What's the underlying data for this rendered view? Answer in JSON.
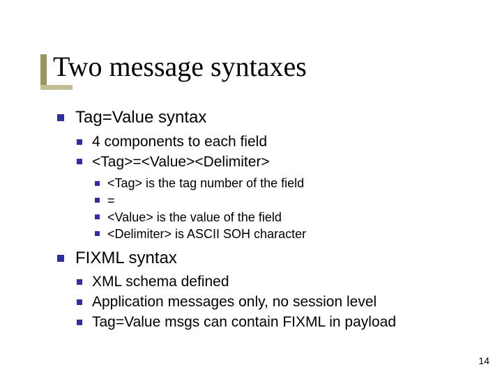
{
  "title": "Two message syntaxes",
  "bullets": {
    "tagvalue": {
      "heading": "Tag=Value syntax",
      "sub": [
        "4 components to each field",
        "<Tag>=<Value><Delimiter>"
      ],
      "subsub": [
        "<Tag> is the tag number of the field",
        "=",
        "<Value> is the value of the field",
        "<Delimiter> is ASCII SOH character"
      ]
    },
    "fixml": {
      "heading": "FIXML syntax",
      "sub": [
        "XML schema defined",
        "Application messages only, no session level",
        "Tag=Value msgs can contain FIXML in payload"
      ]
    }
  },
  "page_number": "14"
}
